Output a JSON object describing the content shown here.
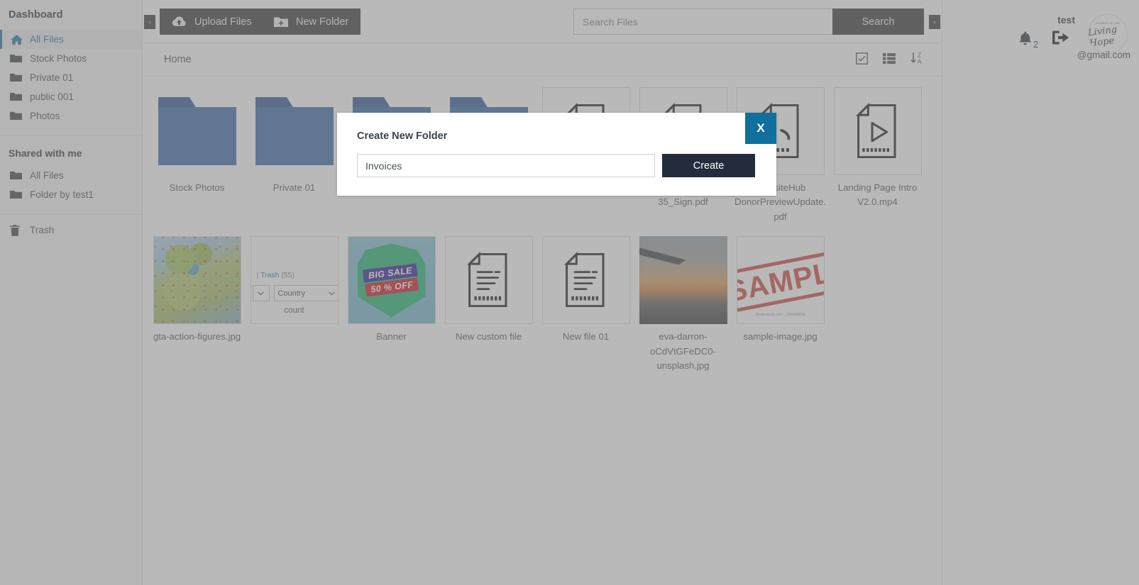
{
  "sidebar": {
    "dashboard_title": "Dashboard",
    "items": [
      {
        "label": "All Files",
        "icon": "home-icon",
        "active": true
      },
      {
        "label": "Stock Photos",
        "icon": "folder-icon",
        "active": false
      },
      {
        "label": "Private 01",
        "icon": "folder-icon",
        "active": false
      },
      {
        "label": "public 001",
        "icon": "folder-icon",
        "active": false
      },
      {
        "label": "Photos",
        "icon": "folder-icon",
        "active": false
      }
    ],
    "shared_title": "Shared with me",
    "shared_items": [
      {
        "label": "All Files",
        "icon": "folder-icon"
      },
      {
        "label": "Folder by test1",
        "icon": "folder-icon"
      }
    ],
    "trash": {
      "label": "Trash",
      "icon": "trash-icon"
    }
  },
  "toolbar": {
    "upload_label": "Upload Files",
    "new_folder_label": "New Folder",
    "search_placeholder": "Search Files",
    "search_value": "",
    "search_button": "Search",
    "collapse_left": "‹",
    "collapse_right": "›"
  },
  "breadcrumb": {
    "home": "Home"
  },
  "view_icons": [
    {
      "name": "select-all-checkbox-icon"
    },
    {
      "name": "list-view-icon"
    },
    {
      "name": "sort-alpha-desc-icon"
    }
  ],
  "user": {
    "name": "test",
    "notification_count": "2",
    "email_suffix": "@gmail.com",
    "email_redacted": "               ",
    "logo_top_text": "CHURCH OF THE",
    "logo_script_text": "Living Hope"
  },
  "modal": {
    "title": "Create New Folder",
    "input_value": "Invoices",
    "input_placeholder": "",
    "create_label": "Create",
    "close_label": "X",
    "accent_color": "#0f6f9d"
  },
  "files": [
    {
      "name": "Stock Photos",
      "type": "folder",
      "thumb": "folder"
    },
    {
      "name": "Private 01",
      "type": "folder",
      "thumb": "folder"
    },
    {
      "name": "",
      "type": "folder",
      "thumb": "folder"
    },
    {
      "name": "",
      "type": "folder",
      "thumb": "folder"
    },
    {
      "name": "",
      "type": "pdf",
      "thumb": "doc"
    },
    {
      "name": "incorporation 35_Sign.pdf",
      "type": "pdf",
      "thumb": "doc"
    },
    {
      "name": "WebsiteHub DonorPreviewUpdate.pdf",
      "type": "pdf",
      "thumb": "doc"
    },
    {
      "name": "Landing Page Intro V2.0.mp4",
      "type": "video",
      "thumb": "video"
    },
    {
      "name": "gta-action-figures.jpg",
      "type": "image",
      "thumb": "map"
    },
    {
      "name": "count",
      "type": "html",
      "thumb": "html-preview"
    },
    {
      "name": "Banner",
      "type": "image",
      "thumb": "banner"
    },
    {
      "name": "New custom file",
      "type": "document",
      "thumb": "doc-lines"
    },
    {
      "name": "New file 01",
      "type": "document",
      "thumb": "doc-lines"
    },
    {
      "name": "eva-darron-oCdVtGFeDC0-unsplash.jpg",
      "type": "image",
      "thumb": "sunset"
    },
    {
      "name": "sample-image.jpg",
      "type": "image",
      "thumb": "sample-stamp"
    }
  ],
  "html_preview": {
    "trash_label": "Trash",
    "trash_count": "(55)",
    "separator": "|",
    "select_label": "Country",
    "caption": "count"
  },
  "sample_image": {
    "stamp_text": "SAMPLE",
    "credit": "shutterstock.com · 1389188556"
  },
  "banner_image": {
    "line1": "BIG SALE",
    "line2": "50 % OFF"
  },
  "colors": {
    "folder_blue": "#4874ad",
    "folder_tab_blue": "#3f63a0",
    "accent_blue": "#2f7fa8",
    "dark_button": "#474747",
    "modal_button": "#222c3c"
  }
}
